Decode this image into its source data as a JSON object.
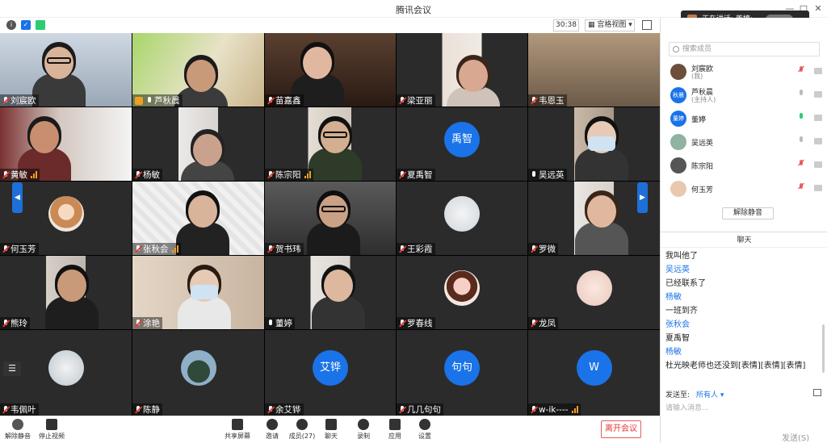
{
  "window": {
    "title": "腾讯会议"
  },
  "infobar": {
    "timer": "30:38",
    "view_label": "宫格视图"
  },
  "speaking": {
    "prefix": "正在讲话:",
    "name": "董婷;"
  },
  "grid": {
    "tiles": [
      {
        "name": "刘宸欧",
        "mic": "muted",
        "signal": false
      },
      {
        "name": "芦秋晨",
        "mic": "on",
        "signal": false,
        "host": true
      },
      {
        "name": "苗嘉鑫",
        "mic": "muted",
        "signal": false
      },
      {
        "name": "梁亚丽",
        "mic": "muted",
        "signal": false
      },
      {
        "name": "韦恩玉",
        "mic": "muted",
        "signal": false
      },
      {
        "name": "黄敏",
        "mic": "muted",
        "signal": true
      },
      {
        "name": "杨敏",
        "mic": "muted",
        "signal": false
      },
      {
        "name": "陈宗阳",
        "mic": "muted",
        "signal": true
      },
      {
        "name": "夏禹智",
        "mic": "muted",
        "signal": false,
        "avatar_text": "禹智"
      },
      {
        "name": "吴远英",
        "mic": "on",
        "signal": false
      },
      {
        "name": "何玉芳",
        "mic": "muted",
        "signal": false
      },
      {
        "name": "张秋会",
        "mic": "muted",
        "signal": true
      },
      {
        "name": "贺书玮",
        "mic": "muted",
        "signal": false
      },
      {
        "name": "王彩霞",
        "mic": "muted",
        "signal": false
      },
      {
        "name": "罗微",
        "mic": "muted",
        "signal": false
      },
      {
        "name": "熊玲",
        "mic": "muted",
        "signal": false
      },
      {
        "name": "涂艳",
        "mic": "muted",
        "signal": false
      },
      {
        "name": "董婷",
        "mic": "on",
        "signal": false
      },
      {
        "name": "罗春线",
        "mic": "muted",
        "signal": false
      },
      {
        "name": "龙凤",
        "mic": "muted",
        "signal": false
      },
      {
        "name": "韦佩叶",
        "mic": "muted",
        "signal": false
      },
      {
        "name": "陈静",
        "mic": "muted",
        "signal": false
      },
      {
        "name": "余艾铧",
        "mic": "muted",
        "signal": false,
        "avatar_text": "艾铧"
      },
      {
        "name": "几几句句",
        "mic": "muted",
        "signal": false,
        "avatar_text": "句句"
      },
      {
        "name": "w-ik----",
        "mic": "muted",
        "signal": true,
        "avatar_text": "W"
      }
    ]
  },
  "toolbar": {
    "unmute": "解除静音",
    "stop_video": "停止视频",
    "share": "共享屏幕",
    "invite": "邀请",
    "members": "成员(27)",
    "chat": "聊天",
    "record": "录制",
    "apps": "应用",
    "settings": "设置",
    "leave": "离开会议"
  },
  "members_panel": {
    "search_placeholder": "搜索成员",
    "members": [
      {
        "name": "刘宸欧",
        "sub": "(我)",
        "avatar": "",
        "avatar_color": "#6b4f3a",
        "mic": "muted"
      },
      {
        "name": "芦秋晨",
        "sub": "(主持人)",
        "avatar": "秋晨",
        "avatar_color": "#1a73e8",
        "mic": "off"
      },
      {
        "name": "董婷",
        "sub": "",
        "avatar": "董婷",
        "avatar_color": "#1a73e8",
        "mic": "green"
      },
      {
        "name": "吴远英",
        "sub": "",
        "avatar": "",
        "avatar_color": "#8fb3a0",
        "mic": "off"
      },
      {
        "name": "陈宗阳",
        "sub": "",
        "avatar": "",
        "avatar_color": "#555555",
        "mic": "muted"
      },
      {
        "name": "何玉芳",
        "sub": "",
        "avatar": "",
        "avatar_color": "#e8c9b0",
        "mic": "muted"
      }
    ],
    "unmute_all": "解除静音"
  },
  "chat": {
    "title": "聊天",
    "lines": [
      {
        "text": "我叫他了",
        "user": false
      },
      {
        "text": "吴远英",
        "user": true
      },
      {
        "text": "已经联系了",
        "user": false
      },
      {
        "text": "杨敏",
        "user": true
      },
      {
        "text": "一班到齐",
        "user": false
      },
      {
        "text": "张秋会",
        "user": true
      },
      {
        "text": "夏禹智",
        "user": false
      },
      {
        "text": "杨敏",
        "user": true
      },
      {
        "text": "杜光映老师也还没到[表情][表情][表情]",
        "user": false
      }
    ],
    "send_to_label": "发送至:",
    "send_to_value": "所有人 ▾",
    "input_placeholder": "请输入消息...",
    "send_button": "发送(S)"
  },
  "colors": {
    "accent": "#1a73e8",
    "leave": "#e53935"
  }
}
